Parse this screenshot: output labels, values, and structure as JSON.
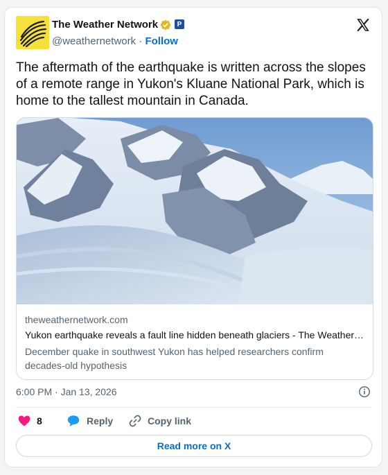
{
  "author": {
    "name": "The Weather Network",
    "handle": "@weathernetwork",
    "separator": "·",
    "follow_label": "Follow",
    "badge_letter": "P"
  },
  "tweet": {
    "text": "The aftermath of the earthquake is written across the slopes of a remote range in Yukon's Kluane National Park, which is home to the tallest mountain in Canada."
  },
  "link_card": {
    "domain": "theweathernetwork.com",
    "title": "Yukon earthquake reveals a fault line hidden beneath glaciers - The Weather Network",
    "description": "December quake in southwest Yukon has helped researchers confirm decades-old hypothesis"
  },
  "meta": {
    "timestamp": "6:00 PM · Jan 13, 2026"
  },
  "actions": {
    "like_count": "8",
    "reply_label": "Reply",
    "copy_label": "Copy link"
  },
  "footer": {
    "read_more_label": "Read more on X"
  },
  "colors": {
    "link_blue": "#006fd6",
    "like_pink": "#f91880",
    "reply_blue": "#1d9bf0",
    "avatar_yellow": "#f5e13a"
  }
}
